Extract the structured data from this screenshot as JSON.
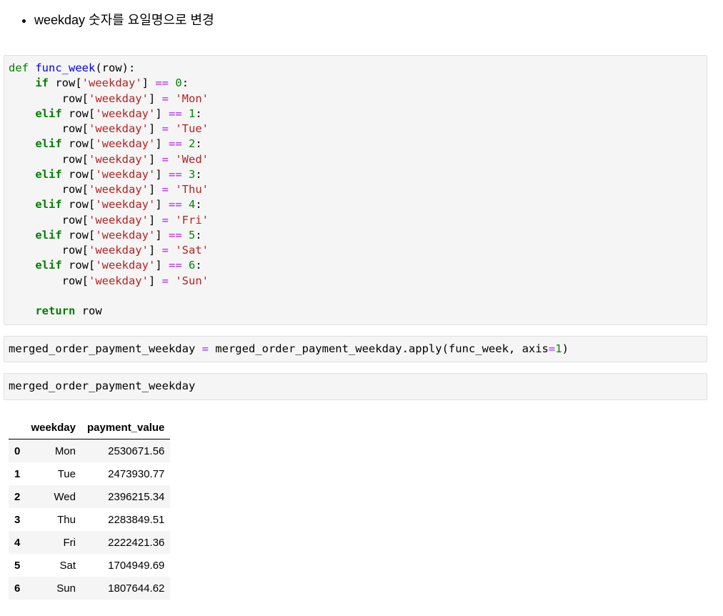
{
  "markdown": {
    "bullet": "weekday 숫자를 요일명으로 변경"
  },
  "cells": {
    "cell2_code": "merged_order_payment_weekday = merged_order_payment_weekday.apply(func_week, axis=1)",
    "cell3_code": "merged_order_payment_weekday"
  },
  "table": {
    "columns": [
      "",
      "weekday",
      "payment_value"
    ],
    "rows": [
      {
        "index": "0",
        "weekday": "Mon",
        "payment_value": "2530671.56"
      },
      {
        "index": "1",
        "weekday": "Tue",
        "payment_value": "2473930.77"
      },
      {
        "index": "2",
        "weekday": "Wed",
        "payment_value": "2396215.34"
      },
      {
        "index": "3",
        "weekday": "Thu",
        "payment_value": "2283849.51"
      },
      {
        "index": "4",
        "weekday": "Fri",
        "payment_value": "2222421.36"
      },
      {
        "index": "5",
        "weekday": "Sat",
        "payment_value": "1704949.69"
      },
      {
        "index": "6",
        "weekday": "Sun",
        "payment_value": "1807644.62"
      }
    ]
  }
}
